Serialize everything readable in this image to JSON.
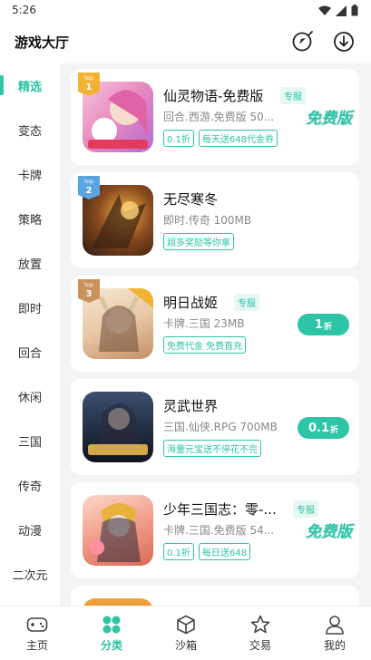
{
  "status": {
    "time": "5:26"
  },
  "header": {
    "title": "游戏大厅",
    "icons": [
      "discover-icon",
      "download-icon"
    ]
  },
  "sidebar": {
    "active_index": 0,
    "items": [
      "精选",
      "变态",
      "卡牌",
      "策略",
      "放置",
      "即时",
      "回合",
      "休闲",
      "三国",
      "传奇",
      "动漫",
      "二次元"
    ]
  },
  "games": [
    {
      "rank": "1",
      "rank_label": "TOP",
      "name": "仙灵物语-免费版",
      "special": "专服",
      "meta": "回合.西游.免费版 50...",
      "tags": [
        "0.1折",
        "每天送648代金券"
      ],
      "badge": "免费版"
    },
    {
      "rank": "2",
      "rank_label": "TOP",
      "name": "无尽寒冬",
      "meta": "即时.传奇 100MB",
      "tags": [
        "超多奖励等你拿"
      ]
    },
    {
      "rank": "3",
      "rank_label": "TOP",
      "name": "明日战姬",
      "special": "专服",
      "meta": "卡牌.三国 23MB",
      "tags": [
        "免费代金 免费直充"
      ],
      "discount": "1",
      "discount_unit": "折"
    },
    {
      "name": "灵武世界",
      "meta": "三国.仙侠.RPG 700MB",
      "tags": [
        "海量元宝送不停花不完"
      ],
      "discount": "0.1",
      "discount_unit": "折"
    },
    {
      "name": "少年三国志：零-...",
      "special": "专服",
      "meta": "卡牌.三国.免费版 54...",
      "tags": [
        "0.1折",
        "每日送648"
      ],
      "badge": "免费版"
    }
  ],
  "tabbar": {
    "active_index": 1,
    "items": [
      {
        "label": "主页",
        "icon": "gamepad-icon"
      },
      {
        "label": "分类",
        "icon": "category-icon"
      },
      {
        "label": "沙箱",
        "icon": "sandbox-icon"
      },
      {
        "label": "交易",
        "icon": "trade-icon"
      },
      {
        "label": "我的",
        "icon": "profile-icon"
      }
    ]
  },
  "colors": {
    "accent": "#2ec4a6",
    "background": "#f3f4f6"
  }
}
